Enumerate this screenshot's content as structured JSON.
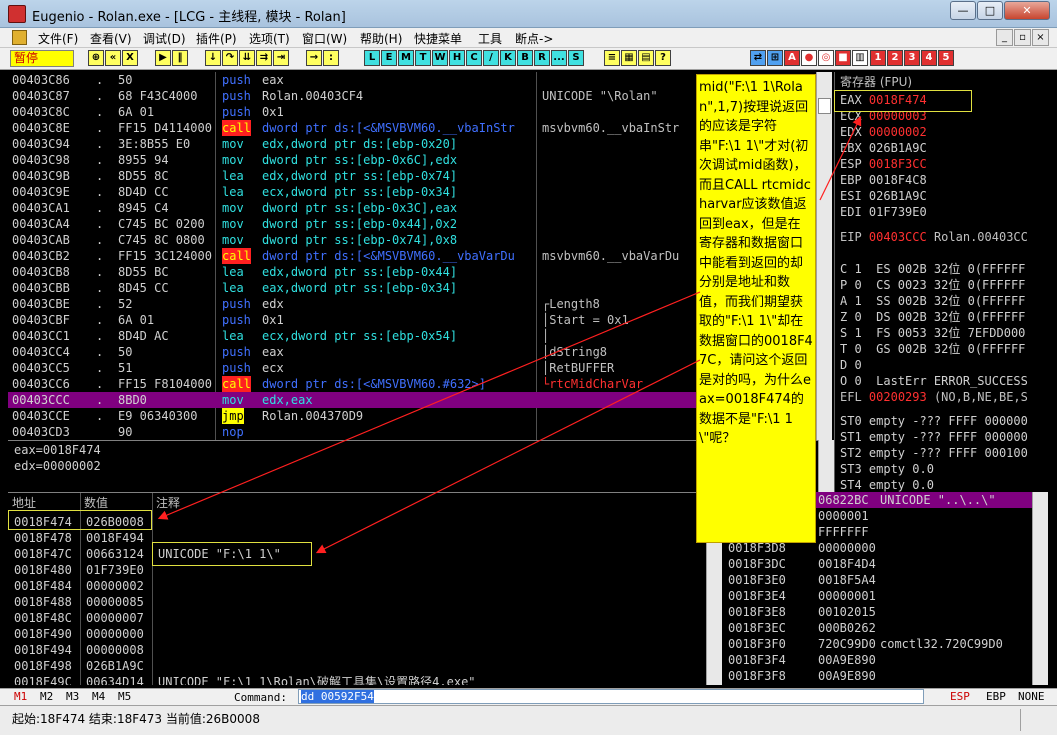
{
  "window": {
    "title": "Eugenio - Rolan.exe - [LCG - 主线程, 模块 - Rolan]",
    "btn_min": "—",
    "btn_max": "□",
    "btn_close": "✕"
  },
  "menu": [
    "文件(F)",
    "查看(V)",
    "调试(D)",
    "插件(P)",
    "选项(T)",
    "窗口(W)",
    "帮助(H)",
    "快捷菜单",
    "工具",
    "断点->"
  ],
  "toolbar": {
    "status": "暂停",
    "letters": [
      "L",
      "E",
      "M",
      "T",
      "W",
      "H",
      "C",
      "/",
      "K",
      "B",
      "R",
      "...",
      "S"
    ],
    "numbers": [
      "1",
      "2",
      "3",
      "4",
      "5"
    ]
  },
  "disasm": [
    {
      "addr": "00403C86",
      "mark": ".",
      "hex": "50",
      "op": "push",
      "args": "eax",
      "c": "",
      "kind": "push"
    },
    {
      "addr": "00403C87",
      "mark": ".",
      "hex": "68 F43C4000",
      "op": "push",
      "args": "Rolan.00403CF4",
      "c": "UNICODE \"\\Rolan\"",
      "kind": "push"
    },
    {
      "addr": "00403C8C",
      "mark": ".",
      "hex": "6A 01",
      "op": "push",
      "args": "0x1",
      "c": "",
      "kind": "push"
    },
    {
      "addr": "00403C8E",
      "mark": ".",
      "hex": "FF15 D4114000",
      "op": "call",
      "args": "dword ptr ds:[<&MSVBVM60.__vbaInStr",
      "c": "msvbvm60.__vbaInStr",
      "kind": "call"
    },
    {
      "addr": "00403C94",
      "mark": ".",
      "hex": "3E:8B55 E0",
      "op": "mov",
      "args": "edx,dword ptr ds:[ebp-0x20]",
      "c": "",
      "kind": "mov"
    },
    {
      "addr": "00403C98",
      "mark": ".",
      "hex": "8955 94",
      "op": "mov",
      "args": "dword ptr ss:[ebp-0x6C],edx",
      "c": "",
      "kind": "mov"
    },
    {
      "addr": "00403C9B",
      "mark": ".",
      "hex": "8D55 8C",
      "op": "lea",
      "args": "edx,dword ptr ss:[ebp-0x74]",
      "c": "",
      "kind": "mov"
    },
    {
      "addr": "00403C9E",
      "mark": ".",
      "hex": "8D4D CC",
      "op": "lea",
      "args": "ecx,dword ptr ss:[ebp-0x34]",
      "c": "",
      "kind": "mov"
    },
    {
      "addr": "00403CA1",
      "mark": ".",
      "hex": "8945 C4",
      "op": "mov",
      "args": "dword ptr ss:[ebp-0x3C],eax",
      "c": "",
      "kind": "mov"
    },
    {
      "addr": "00403CA4",
      "mark": ".",
      "hex": "C745 BC 0200",
      "op": "mov",
      "args": "dword ptr ss:[ebp-0x44],0x2",
      "c": "",
      "kind": "mov"
    },
    {
      "addr": "00403CAB",
      "mark": ".",
      "hex": "C745 8C 0800",
      "op": "mov",
      "args": "dword ptr ss:[ebp-0x74],0x8",
      "c": "",
      "kind": "mov"
    },
    {
      "addr": "00403CB2",
      "mark": ".",
      "hex": "FF15 3C124000",
      "op": "call",
      "args": "dword ptr ds:[<&MSVBVM60.__vbaVarDu",
      "c": "msvbvm60.__vbaVarDu",
      "kind": "call"
    },
    {
      "addr": "00403CB8",
      "mark": ".",
      "hex": "8D55 BC",
      "op": "lea",
      "args": "edx,dword ptr ss:[ebp-0x44]",
      "c": "",
      "kind": "mov"
    },
    {
      "addr": "00403CBB",
      "mark": ".",
      "hex": "8D45 CC",
      "op": "lea",
      "args": "eax,dword ptr ss:[ebp-0x34]",
      "c": "",
      "kind": "mov"
    },
    {
      "addr": "00403CBE",
      "mark": ".",
      "hex": "52",
      "op": "push",
      "args": "edx",
      "c": "┌Length8",
      "kind": "push"
    },
    {
      "addr": "00403CBF",
      "mark": ".",
      "hex": "6A 01",
      "op": "push",
      "args": "0x1",
      "c": "│Start = 0x1",
      "kind": "push"
    },
    {
      "addr": "00403CC1",
      "mark": ".",
      "hex": "8D4D AC",
      "op": "lea",
      "args": "ecx,dword ptr ss:[ebp-0x54]",
      "c": "│",
      "kind": "mov"
    },
    {
      "addr": "00403CC4",
      "mark": ".",
      "hex": "50",
      "op": "push",
      "args": "eax",
      "c": "│dString8",
      "kind": "push"
    },
    {
      "addr": "00403CC5",
      "mark": ".",
      "hex": "51",
      "op": "push",
      "args": "ecx",
      "c": "│RetBUFFER",
      "kind": "push"
    },
    {
      "addr": "00403CC6",
      "mark": ".",
      "hex": "FF15 F8104000",
      "op": "call",
      "args": "dword ptr ds:[<&MSVBVM60.#632>]",
      "c": "└rtcMidCharVar",
      "kind": "call"
    },
    {
      "addr": "00403CCC",
      "mark": ".",
      "hex": "8BD0",
      "op": "mov",
      "args": "edx,eax",
      "c": "",
      "kind": "mov"
    },
    {
      "addr": "00403CCE",
      "mark": ".",
      "hex": "E9 06340300",
      "op": "jmp",
      "args": "Rolan.004370D9",
      "c": "",
      "kind": "jmp"
    },
    {
      "addr": "00403CD3",
      "mark": "",
      "hex": "90",
      "op": "nop",
      "args": "",
      "c": "",
      "kind": "nop"
    }
  ],
  "info": [
    "eax=0018F474",
    "edx=00000002"
  ],
  "registers": {
    "title": "寄存器 (FPU)",
    "gp": [
      {
        "n": "EAX",
        "v": "0018F474",
        "c": ""
      },
      {
        "n": "ECX",
        "v": "00000003",
        "c": ""
      },
      {
        "n": "EDX",
        "v": "00000002",
        "c": ""
      },
      {
        "n": "EBX",
        "v": "026B1A9C",
        "c": ""
      },
      {
        "n": "ESP",
        "v": "0018F3CC",
        "c": ""
      },
      {
        "n": "EBP",
        "v": "0018F4C8",
        "c": ""
      },
      {
        "n": "ESI",
        "v": "026B1A9C",
        "c": ""
      },
      {
        "n": "EDI",
        "v": "01F739E0",
        "c": ""
      }
    ],
    "eip": {
      "n": "EIP",
      "v": "00403CCC",
      "c": "Rolan.00403CC"
    },
    "flags": [
      "C 1  ES 002B 32位 0(FFFFFF",
      "P 0  CS 0023 32位 0(FFFFFF",
      "A 1  SS 002B 32位 0(FFFFFF",
      "Z 0  DS 002B 32位 0(FFFFFF",
      "S 1  FS 0053 32位 7EFDD000",
      "T 0  GS 002B 32位 0(FFFFFF",
      "D 0",
      "O 0  LastErr ERROR_SUCCESS"
    ],
    "efl": {
      "n": "EFL",
      "v": "00200293",
      "c": "(NO,B,NE,BE,S"
    },
    "st": [
      "ST0 empty -??? FFFF 000000",
      "ST1 empty -??? FFFF 000000",
      "ST2 empty -??? FFFF 000100",
      "ST3 empty 0.0",
      "ST4 empty 0.0"
    ]
  },
  "note": "mid(\"F:\\1 1\\Rolan\",1,7)按理说返回的应该是字符串\"F:\\1 1\\\"才对(初次调试mid函数)，而且CALL rtcmidcharvar应该数值返回到eax，但是在寄存器和数据窗口中能看到返回的却分别是地址和数值，而我们期望获取的\"F:\\1 1\\\"却在数据窗口的0018F47C，请问这个返回是对的吗，为什么eax=0018F474的数据不是\"F:\\1 1\\\"呢？",
  "dump": {
    "headers": [
      "地址",
      "数值",
      "注释"
    ],
    "rows": [
      {
        "a": "0018F474",
        "v": "026B0008",
        "c": ""
      },
      {
        "a": "0018F478",
        "v": "0018F494",
        "c": ""
      },
      {
        "a": "0018F47C",
        "v": "00663124",
        "c": "UNICODE \"F:\\1 1\\\""
      },
      {
        "a": "0018F480",
        "v": "01F739E0",
        "c": ""
      },
      {
        "a": "0018F484",
        "v": "00000002",
        "c": ""
      },
      {
        "a": "0018F488",
        "v": "00000085",
        "c": ""
      },
      {
        "a": "0018F48C",
        "v": "00000007",
        "c": ""
      },
      {
        "a": "0018F490",
        "v": "00000000",
        "c": ""
      },
      {
        "a": "0018F494",
        "v": "00000008",
        "c": ""
      },
      {
        "a": "0018F498",
        "v": "026B1A9C",
        "c": ""
      },
      {
        "a": "0018F49C",
        "v": "00634D14",
        "c": "UNICODE \"F:\\1 1\\Rolan\\破解工具集\\设置路径4.exe\""
      }
    ]
  },
  "stack": [
    {
      "a": "",
      "v": "06822BC",
      "c": "UNICODE \"..\\..\\\"",
      "hl": true
    },
    {
      "a": "",
      "v": "0000001",
      "c": "",
      "hl": false
    },
    {
      "a": "",
      "v": "FFFFFFF",
      "c": "",
      "hl": false
    },
    {
      "a": "0018F3D8",
      "v": "00000000",
      "c": "",
      "hl": false
    },
    {
      "a": "0018F3DC",
      "v": "0018F4D4",
      "c": "",
      "hl": false
    },
    {
      "a": "0018F3E0",
      "v": "0018F5A4",
      "c": "",
      "hl": false
    },
    {
      "a": "0018F3E4",
      "v": "00000001",
      "c": "",
      "hl": false
    },
    {
      "a": "0018F3E8",
      "v": "00102015",
      "c": "",
      "hl": false
    },
    {
      "a": "0018F3EC",
      "v": "000B0262",
      "c": "",
      "hl": false
    },
    {
      "a": "0018F3F0",
      "v": "720C99D0",
      "c": "comctl32.720C99D0",
      "hl": false
    },
    {
      "a": "0018F3F4",
      "v": "00A9E890",
      "c": "",
      "hl": false
    },
    {
      "a": "0018F3F8",
      "v": "00A9E890",
      "c": "",
      "hl": false
    }
  ],
  "cmdbar": {
    "tabs": [
      "M1",
      "M2",
      "M3",
      "M4",
      "M5"
    ],
    "label": "Command:",
    "value": "dd 00592F54",
    "right": [
      "ESP",
      "EBP",
      "NONE"
    ]
  },
  "status": "起始:18F474 结束:18F473 当前值:26B0008",
  "colors": {
    "accent_red": "#ff3030",
    "highlight_row": "#800080",
    "note_bg": "#ffff00"
  }
}
